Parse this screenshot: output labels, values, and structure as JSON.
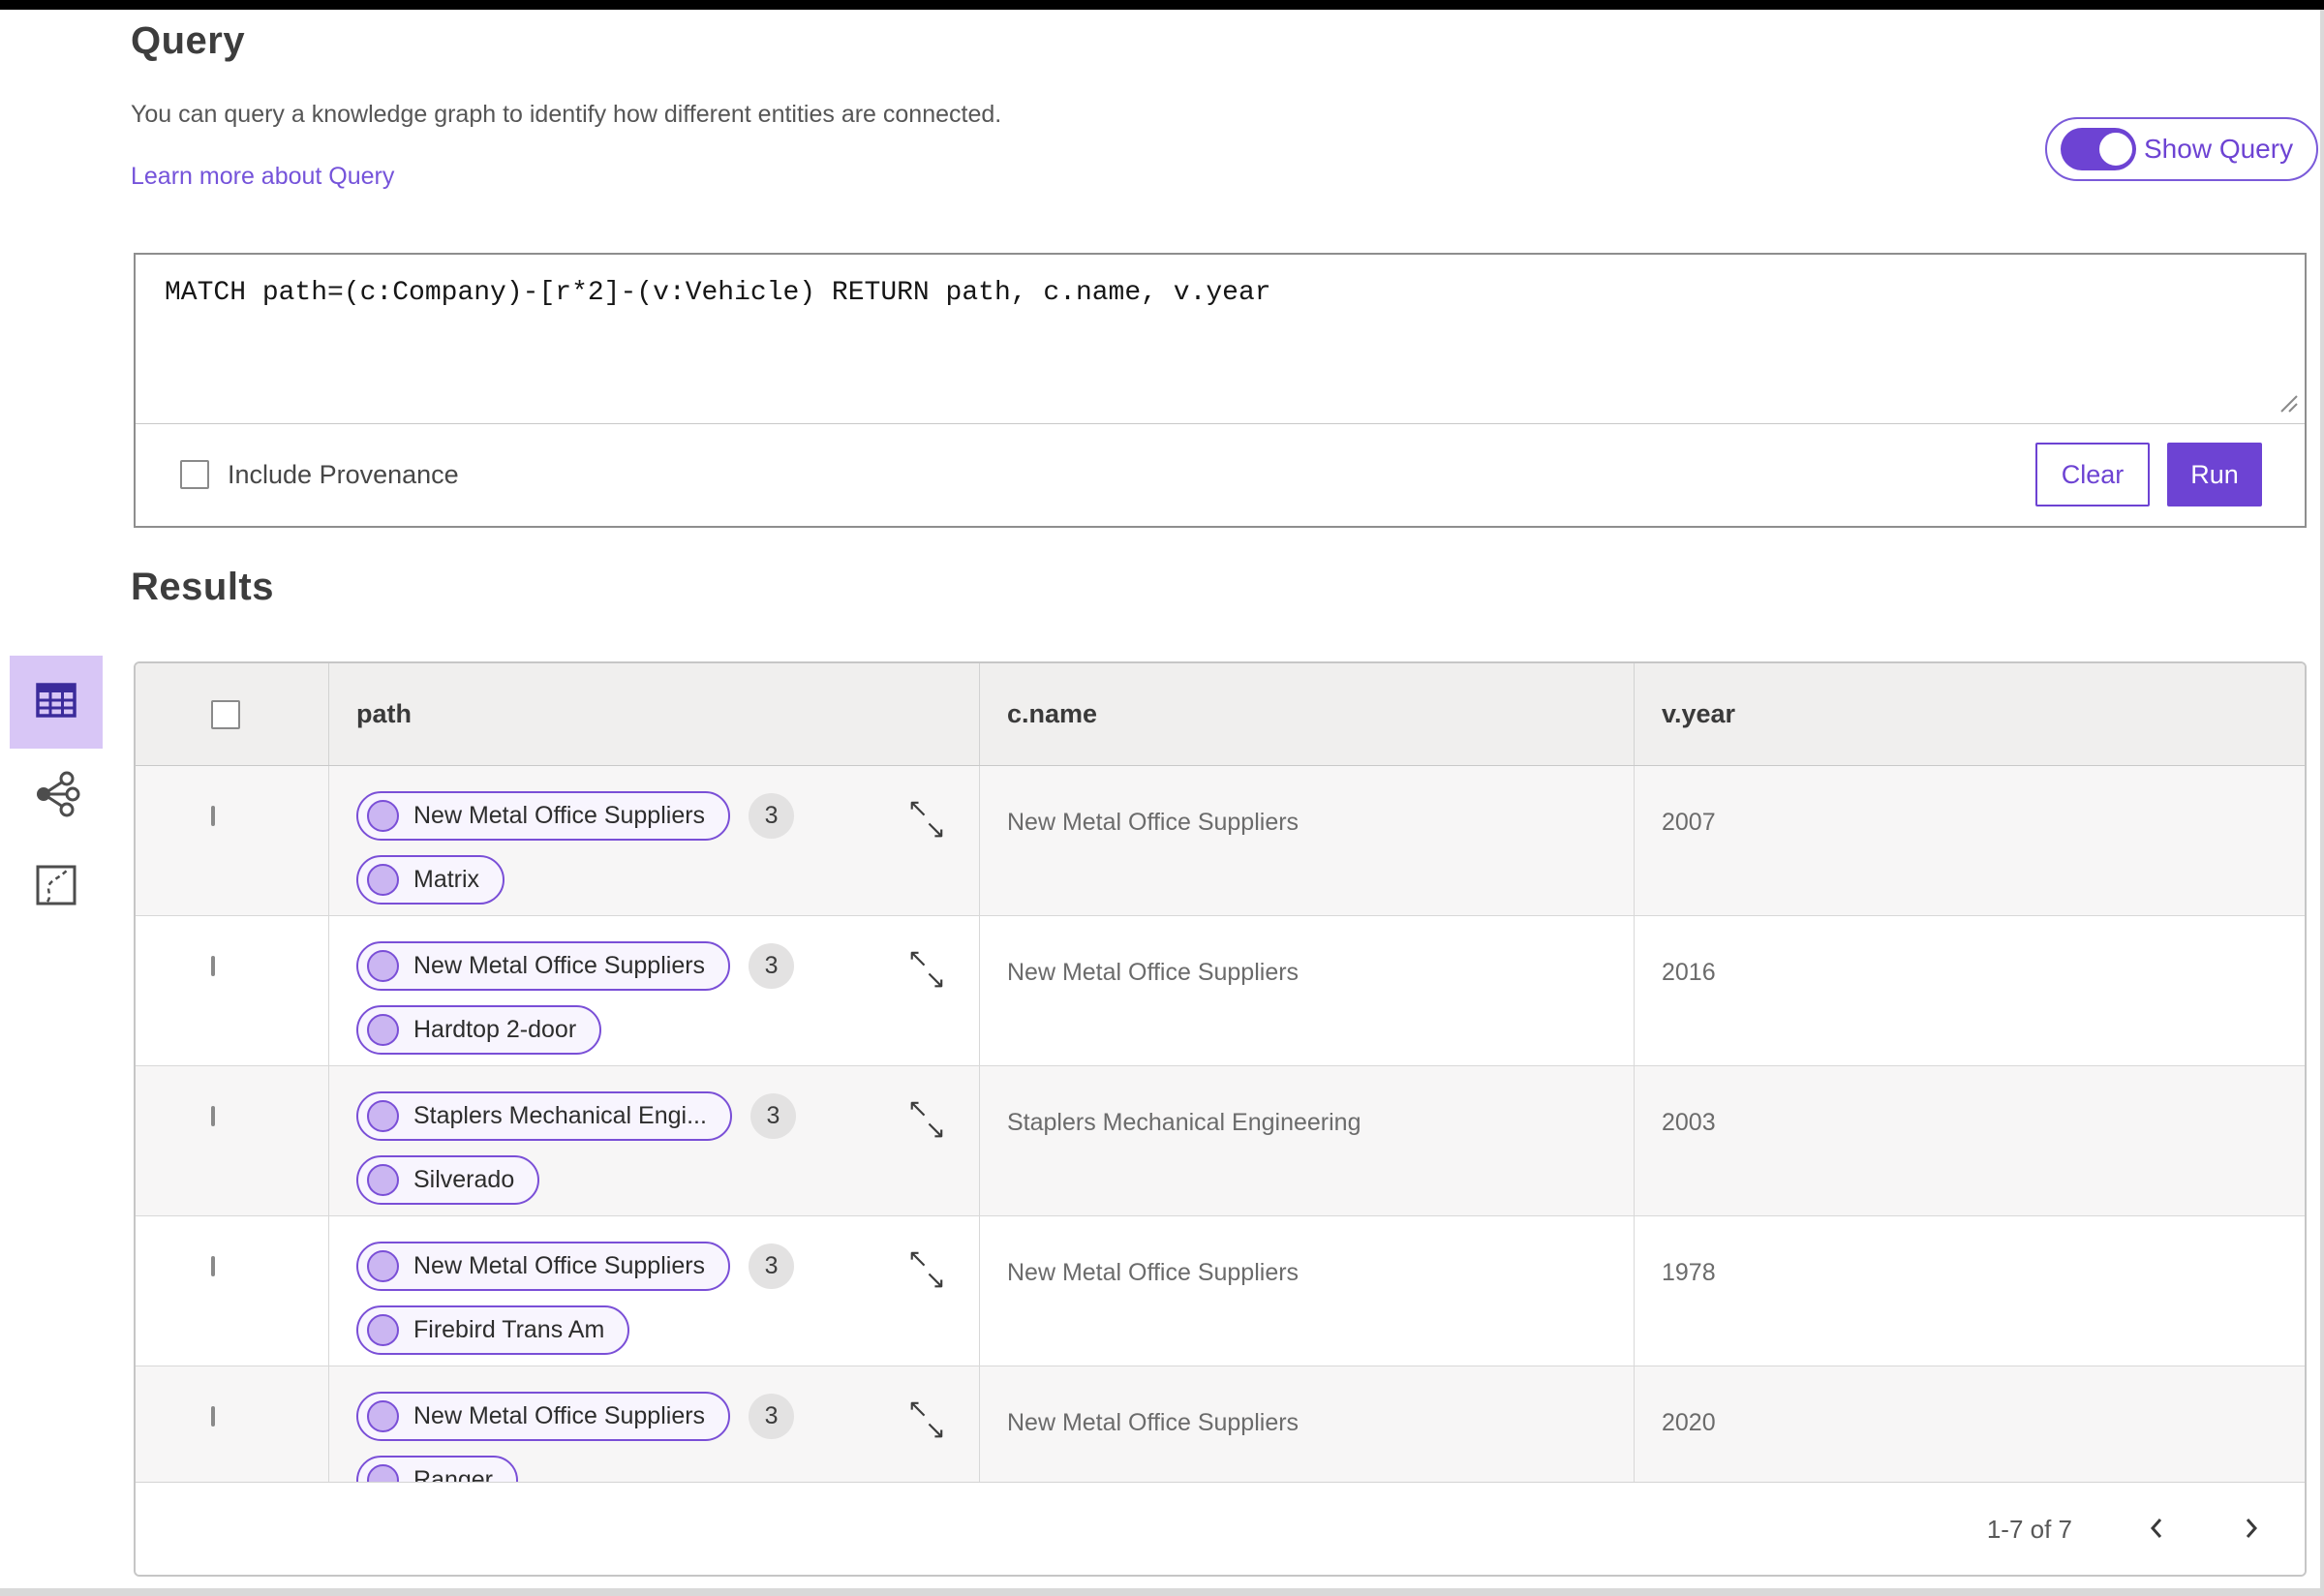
{
  "colors": {
    "accent_purple": "#6d43d3",
    "pill_border": "#7a4fd7",
    "pill_background": "#f8f5fe",
    "node_circle_fill": "#cbb6f2",
    "selected_view_background": "#d8c6f6",
    "link_purple": "#7553da"
  },
  "query_section": {
    "title": "Query",
    "description": "You can query a knowledge graph to identify how different entities are connected.",
    "learn_more_link": "Learn more about Query",
    "show_query_label": "Show Query",
    "show_query_state": "on",
    "query_text": "MATCH path=(c:Company)-[r*2]-(v:Vehicle) RETURN path, c.name, v.year",
    "include_provenance_label": "Include Provenance",
    "include_provenance_checked": false,
    "clear_label": "Clear",
    "run_label": "Run"
  },
  "results_section": {
    "title": "Results",
    "view_rail": {
      "icons": [
        "table-view-icon",
        "graph-view-icon",
        "map-view-icon"
      ],
      "selected": "table-view-icon"
    },
    "table": {
      "columns": [
        "path",
        "c.name",
        "v.year"
      ],
      "rows": [
        {
          "path_start": "New Metal Office Suppliers",
          "path_end": "Matrix",
          "hops": "3",
          "c_name": "New Metal Office Suppliers",
          "v_year": "2007"
        },
        {
          "path_start": "New Metal Office Suppliers",
          "path_end": "Hardtop 2-door",
          "hops": "3",
          "c_name": "New Metal Office Suppliers",
          "v_year": "2016"
        },
        {
          "path_start": "Staplers Mechanical Engi...",
          "path_end": "Silverado",
          "hops": "3",
          "c_name": "Staplers Mechanical Engineering",
          "v_year": "2003"
        },
        {
          "path_start": "New Metal Office Suppliers",
          "path_end": "Firebird Trans Am",
          "hops": "3",
          "c_name": "New Metal Office Suppliers",
          "v_year": "1978"
        },
        {
          "path_start": "New Metal Office Suppliers",
          "path_end": "Ranger",
          "hops": "3",
          "c_name": "New Metal Office Suppliers",
          "v_year": "2020"
        }
      ],
      "pagination": {
        "range_label": "1-7 of 7"
      }
    }
  }
}
